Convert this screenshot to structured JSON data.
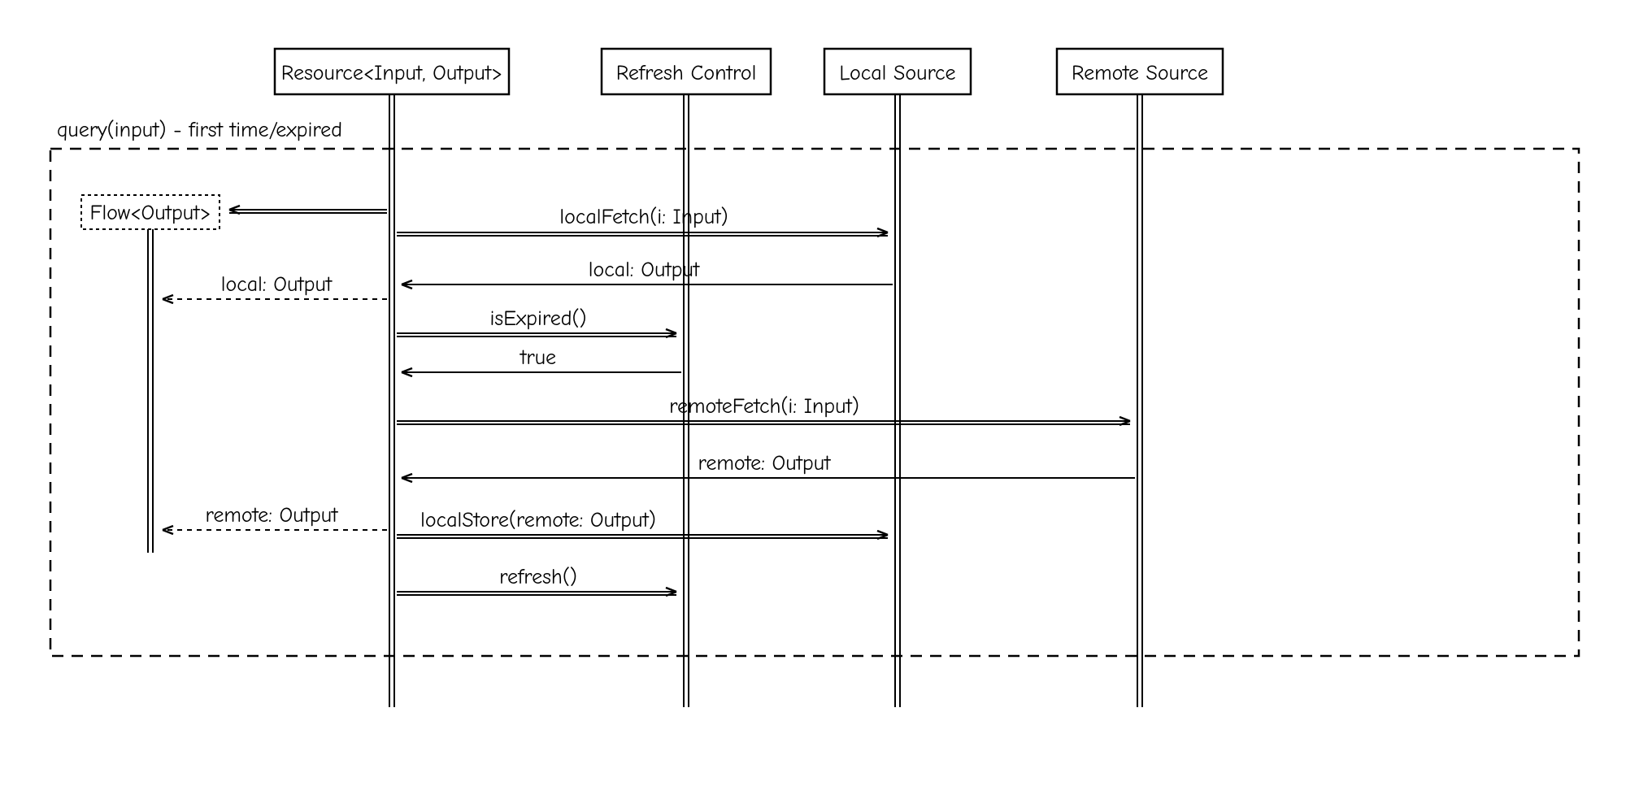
{
  "participants": {
    "resource": "Resource<Input, Output>",
    "refresh": "Refresh Control",
    "local": "Local Source",
    "remote": "Remote Source"
  },
  "frame": {
    "label": "query(input) - first time/expired"
  },
  "note": {
    "flow": "Flow<Output>"
  },
  "messages": {
    "localFetch": "localFetch(i: Input)",
    "localOutput": "local: Output",
    "emitLocal": "local: Output",
    "isExpired": "isExpired()",
    "trueVal": "true",
    "remoteFetch": "remoteFetch(i: Input)",
    "remoteOutput": "remote: Output",
    "emitRemote": "remote: Output",
    "localStore": "localStore(remote: Output)",
    "refresh": "refresh()"
  }
}
